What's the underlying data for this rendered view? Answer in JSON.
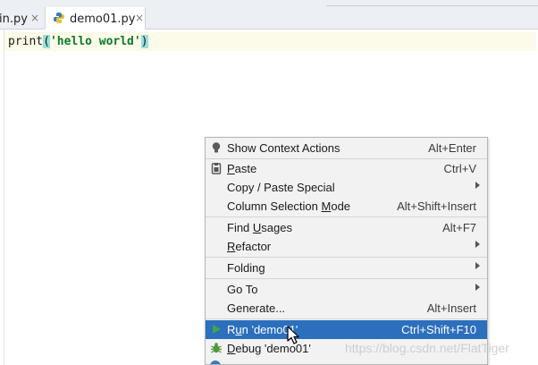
{
  "tabs": {
    "main_label": "in.py",
    "demo_label": "demo01.py",
    "close_glyph": "×"
  },
  "editor": {
    "code_fn": "print",
    "code_open": "(",
    "code_string": "'hello world'",
    "code_close": ")"
  },
  "context_menu": {
    "items": [
      {
        "label": "Show Context Actions",
        "shortcut": "Alt+Enter",
        "icon": "lightbulb-icon"
      },
      {
        "label_u": "P",
        "label_rest": "aste",
        "shortcut": "Ctrl+V",
        "icon": "clipboard-icon"
      },
      {
        "label": "Copy / Paste Special",
        "submenu": true
      },
      {
        "label_pre": "Column Selection ",
        "label_u": "M",
        "label_rest": "ode",
        "shortcut": "Alt+Shift+Insert"
      },
      {
        "label_pre": "Find ",
        "label_u": "U",
        "label_rest": "sages",
        "shortcut": "Alt+F7"
      },
      {
        "label_u": "R",
        "label_rest": "efactor",
        "submenu": true
      },
      {
        "label": "Folding",
        "submenu": true
      },
      {
        "label": "Go To",
        "submenu": true
      },
      {
        "label": "Generate...",
        "shortcut": "Alt+Insert"
      },
      {
        "label_pre": "R",
        "label_u": "u",
        "label_rest": "n 'demo01'",
        "shortcut": "Ctrl+Shift+F10",
        "icon": "run-icon",
        "selected": true
      },
      {
        "label_u": "D",
        "label_rest": "ebug 'demo01'",
        "icon": "debug-icon"
      }
    ]
  },
  "watermark": "https://blog.csdn.net/FlatTiger",
  "colors": {
    "selection": "#2c6fbd",
    "run_green": "#3fa64a",
    "string_green": "#0b7a2c",
    "brace_match": "#9ae0dc"
  }
}
